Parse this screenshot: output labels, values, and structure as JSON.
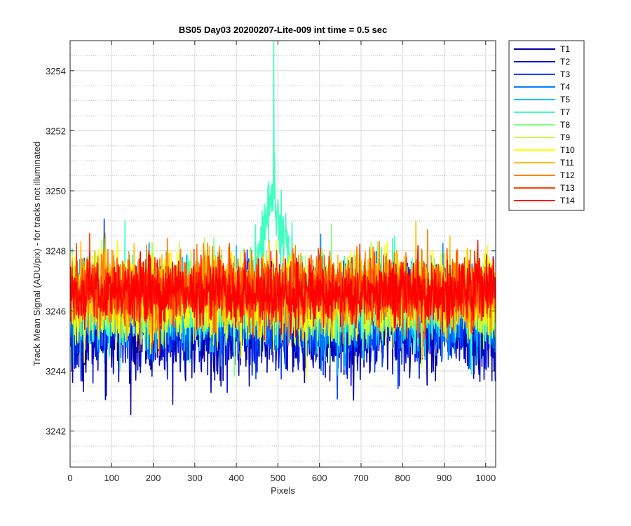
{
  "chart_data": {
    "type": "line",
    "title": "BS05 Day03 20200207-Lite-009 int time = 0.5 sec",
    "xlabel": "Pixels",
    "ylabel": "Track Mean Signal (ADU/pix) - for tracks not illuminated",
    "xlim": [
      0,
      1024
    ],
    "ylim": [
      3240.8,
      3255
    ],
    "xticks": [
      0,
      100,
      200,
      300,
      400,
      500,
      600,
      700,
      800,
      900,
      1000
    ],
    "xtick_labels": [
      "0",
      "100",
      "200",
      "300",
      "400",
      "500",
      "600",
      "700",
      "800",
      "900",
      "1000"
    ],
    "yticks": [
      3242,
      3244,
      3246,
      3248,
      3250,
      3252,
      3254
    ],
    "ytick_labels": [
      "3242",
      "3244",
      "3246",
      "3248",
      "3250",
      "3252",
      "3254"
    ],
    "grid": true,
    "minor_grid_y": true,
    "legend_position": "outside-right-top",
    "series": [
      {
        "name": "T1",
        "color": "#0000A8",
        "mean": 3245.3,
        "spread": 1.05
      },
      {
        "name": "T2",
        "color": "#0010D8",
        "mean": 3245.6,
        "spread": 1.0
      },
      {
        "name": "T3",
        "color": "#0040FF",
        "mean": 3245.9,
        "spread": 0.95
      },
      {
        "name": "T4",
        "color": "#0080FF",
        "mean": 3246.0,
        "spread": 0.9
      },
      {
        "name": "T5",
        "color": "#00C0FF",
        "mean": 3246.1,
        "spread": 0.9
      },
      {
        "name": "T7",
        "color": "#40FFC0",
        "mean": 3246.4,
        "spread": 0.9,
        "feature": {
          "type": "peak",
          "center": 490,
          "width": 40,
          "height": 3.2,
          "max": 3255.0
        }
      },
      {
        "name": "T8",
        "color": "#80FF80",
        "mean": 3246.3,
        "spread": 0.85
      },
      {
        "name": "T9",
        "color": "#C0FF40",
        "mean": 3246.4,
        "spread": 0.85
      },
      {
        "name": "T10",
        "color": "#FFFF00",
        "mean": 3246.5,
        "spread": 0.9
      },
      {
        "name": "T11",
        "color": "#FFC000",
        "mean": 3246.6,
        "spread": 0.85
      },
      {
        "name": "T12",
        "color": "#FF8000",
        "mean": 3246.7,
        "spread": 0.8
      },
      {
        "name": "T13",
        "color": "#FF4000",
        "mean": 3246.7,
        "spread": 0.75
      },
      {
        "name": "T14",
        "color": "#FF0000",
        "mean": 3246.6,
        "spread": 0.7
      }
    ]
  }
}
